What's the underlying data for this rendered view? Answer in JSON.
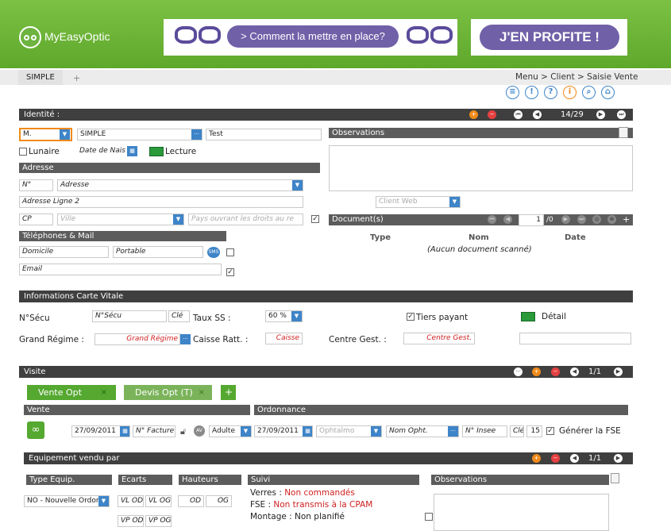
{
  "brand": {
    "name": "MyEasyOptic"
  },
  "banner": {
    "cta1": "> Comment la mettre en place?",
    "cta2": "J'EN PROFITE !"
  },
  "tabs": {
    "active": "SIMPLE",
    "add": "+"
  },
  "breadcrumb": "Menu > Client > Saisie Vente",
  "toolbar_icons": [
    "list-icon",
    "alert-icon",
    "help-icon",
    "info-icon",
    "search-user-icon",
    "home-icon"
  ],
  "identite": {
    "title": "Identité :",
    "counter": "14/29",
    "civilite": "M.",
    "nom": "SIMPLE",
    "prenom": "Test",
    "lunaire": "Lunaire",
    "date_naissance": "Date de Nais",
    "lecture": "Lecture",
    "adresse_header": "Adresse",
    "num": "N°",
    "adresse": "Adresse",
    "adresse2": "Adresse Ligne 2",
    "cp": "CP",
    "ville": "Ville",
    "pays": "Pays ouvrant les droits au re",
    "tel_header": "Téléphones & Mail",
    "domicile": "Domicile",
    "portable": "Portable",
    "sms": "SMS",
    "email": "Email"
  },
  "observations": {
    "title": "Observations",
    "client_web": "Client Web"
  },
  "documents": {
    "title": "Document(s)",
    "page": "1",
    "total": "/0",
    "col_type": "Type",
    "col_nom": "Nom",
    "col_date": "Date",
    "empty": "(Aucun document scanné)"
  },
  "vitale": {
    "title": "Informations Carte Vitale",
    "nsecu_label": "N°Sécu",
    "nsecu": "N°Sécu",
    "cle": "Clé",
    "taux_label": "Taux SS :",
    "taux": "60 %",
    "tiers": "Tiers payant",
    "detail": "Détail",
    "regime_label": "Grand Régime :",
    "regime": "Grand Régime",
    "caisse_label": "Caisse Ratt. :",
    "caisse": "Caisse",
    "centre_label": "Centre Gest. :",
    "centre": "Centre Gest."
  },
  "visite": {
    "title": "Visite",
    "counter": "1/1",
    "tab1": "Vente Opt",
    "tab2": "Devis Opt (T)",
    "add": "+",
    "vente_header": "Vente",
    "ordonnance_header": "Ordonnance",
    "date_vente": "27/09/2011",
    "facture": "N° Facture",
    "av": "AV",
    "type": "Adulte",
    "date_ord": "27/09/2011",
    "ophtalmo": "Ophtalmo",
    "nom_opht": "Nom Opht.",
    "insee": "N° Insee",
    "cle": "Clé",
    "cle_val": "15",
    "generer": "Générer la FSE"
  },
  "equipement": {
    "title": "Equipement vendu par",
    "counter": "1/1",
    "type_header": "Type Equip.",
    "ecarts_header": "Ecarts",
    "hauteurs_header": "Hauteurs",
    "suivi_header": "Suivi",
    "obs_header": "Observations",
    "type_value": "NO - Nouvelle Ordon",
    "vl_od": "VL OD",
    "vl_og": "VL OG",
    "vp_od": "VP OD",
    "vp_og": "VP OG",
    "od": "OD",
    "og": "OG",
    "verres_label": "Verres : ",
    "verres_value": "Non commandés",
    "fse_label": "FSE : ",
    "fse_value": "Non transmis à la CPAM",
    "montage_label": "Montage : ",
    "montage_value": "Non planifié"
  },
  "colors": {
    "green": "#5ea82c",
    "header": "#3f3f3f",
    "blue": "#3e84c8",
    "red": "#d02020",
    "purple": "#7060a8"
  }
}
